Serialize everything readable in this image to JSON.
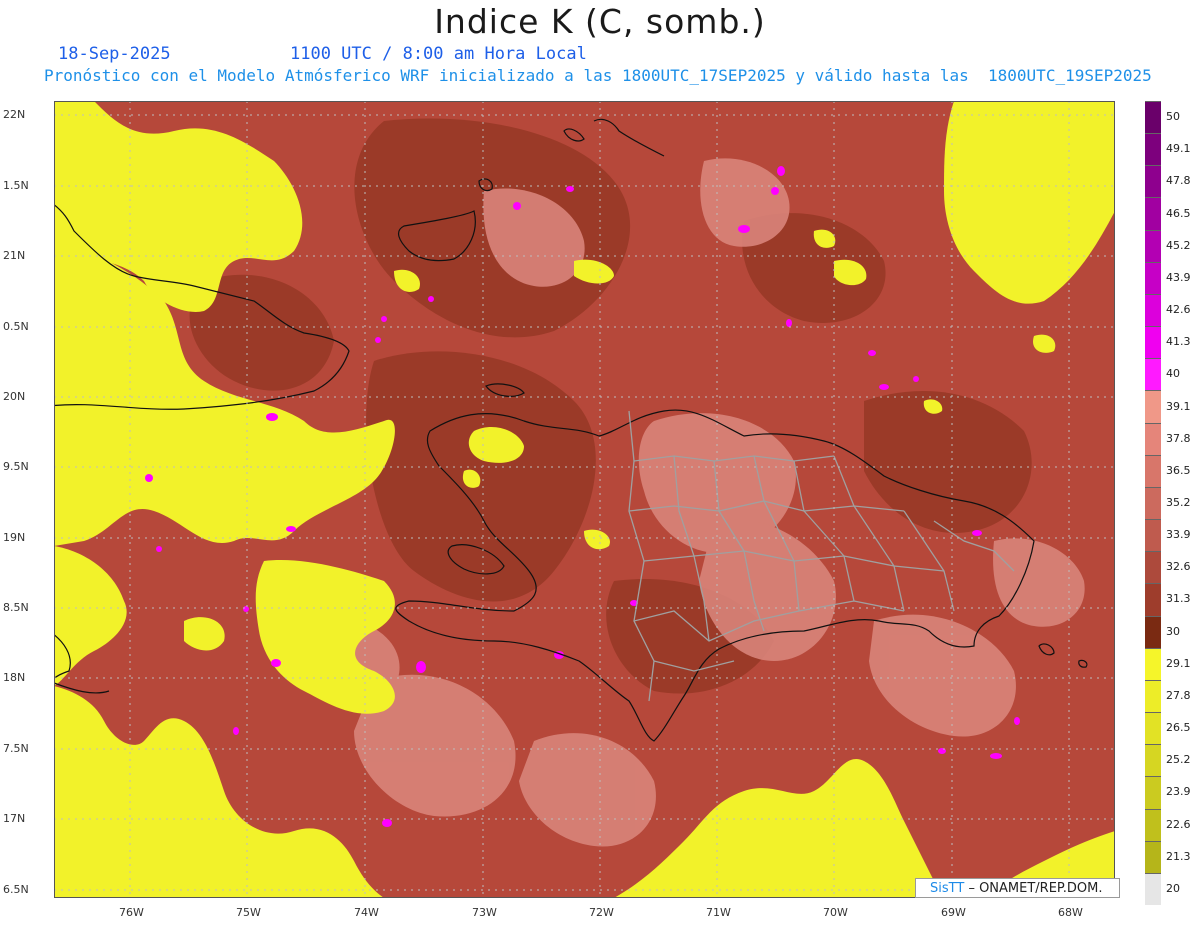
{
  "header": {
    "title": "Indice K (C, somb.)",
    "date": "18-Sep-2025",
    "time": "1100 UTC / 8:00 am Hora Local",
    "info": "Pronóstico con el Modelo Atmósferico WRF inicializado a las 1800UTC_17SEP2025 y válido hasta las  1800UTC_19SEP2025"
  },
  "map": {
    "lat_labels": [
      "22N",
      "1.5N",
      "21N",
      "0.5N",
      "20N",
      "9.5N",
      "19N",
      "8.5N",
      "18N",
      "7.5N",
      "17N",
      "6.5N"
    ],
    "lon_labels": [
      "76W",
      "75W",
      "74W",
      "73W",
      "72W",
      "71W",
      "70W",
      "69W",
      "68W"
    ],
    "colors": {
      "below_30": "#f2f22a",
      "range_30_33": "#9b3a28",
      "range_33_37": "#c45a4c",
      "range_37_40": "#d9847a",
      "above_40": "#ff00ff",
      "coastline": "#111111",
      "provinces": "#a0a0a0"
    }
  },
  "colorbar": {
    "labels": [
      "50",
      "49.1",
      "47.8",
      "46.5",
      "45.2",
      "43.9",
      "42.6",
      "41.3",
      "40",
      "39.1",
      "37.8",
      "36.5",
      "35.2",
      "33.9",
      "32.6",
      "31.3",
      "30",
      "29.1",
      "27.8",
      "26.5",
      "25.2",
      "23.9",
      "22.6",
      "21.3",
      "20"
    ],
    "colors": [
      "#6a006a",
      "#7d007d",
      "#8e008e",
      "#a100a1",
      "#b300b3",
      "#c600c6",
      "#dc00dc",
      "#f000f0",
      "#ff1aff",
      "#f09888",
      "#e5857a",
      "#d8766a",
      "#cc6a5e",
      "#bf5b4e",
      "#ad4a3c",
      "#9e3d2c",
      "#7a2a12",
      "#f5f52a",
      "#eded28",
      "#e2e225",
      "#d6d622",
      "#cbcb20",
      "#c0c01c",
      "#b5b51a",
      "#e6e6e6"
    ]
  },
  "credit": {
    "brand": "SisTT",
    "rest": "– ONAMET/REP.DOM."
  }
}
